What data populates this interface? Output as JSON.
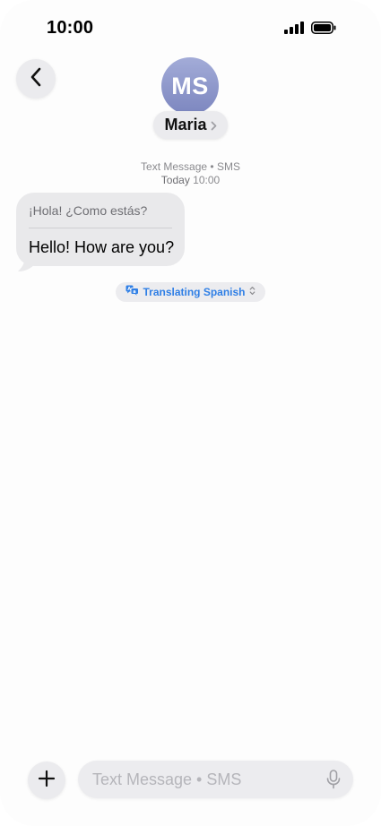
{
  "status_bar": {
    "time": "10:00",
    "signal_icon": "cellular-signal-icon",
    "battery_icon": "battery-icon"
  },
  "header": {
    "back_icon": "chevron-left-icon",
    "avatar_initials": "MS",
    "contact_name": "Maria",
    "contact_chevron_icon": "chevron-right-icon"
  },
  "conversation": {
    "service_line": "Text Message • SMS",
    "date_prefix": "Today",
    "date_time": "10:00"
  },
  "messages": [
    {
      "original": "¡Hola! ¿Como estás?",
      "translated": "Hello! How are you?",
      "direction": "incoming"
    }
  ],
  "translation": {
    "label": "Translating Spanish",
    "icon": "translate-icon",
    "chevron_icon": "chevron-up-down-icon",
    "color": "#2f7fe6"
  },
  "input_bar": {
    "plus_icon": "plus-icon",
    "placeholder": "Text Message • SMS",
    "value": "",
    "mic_icon": "microphone-icon"
  },
  "colors": {
    "bubble": "#e9e9eb",
    "avatar_top": "#a3acd8",
    "avatar_bottom": "#7c86bf"
  }
}
